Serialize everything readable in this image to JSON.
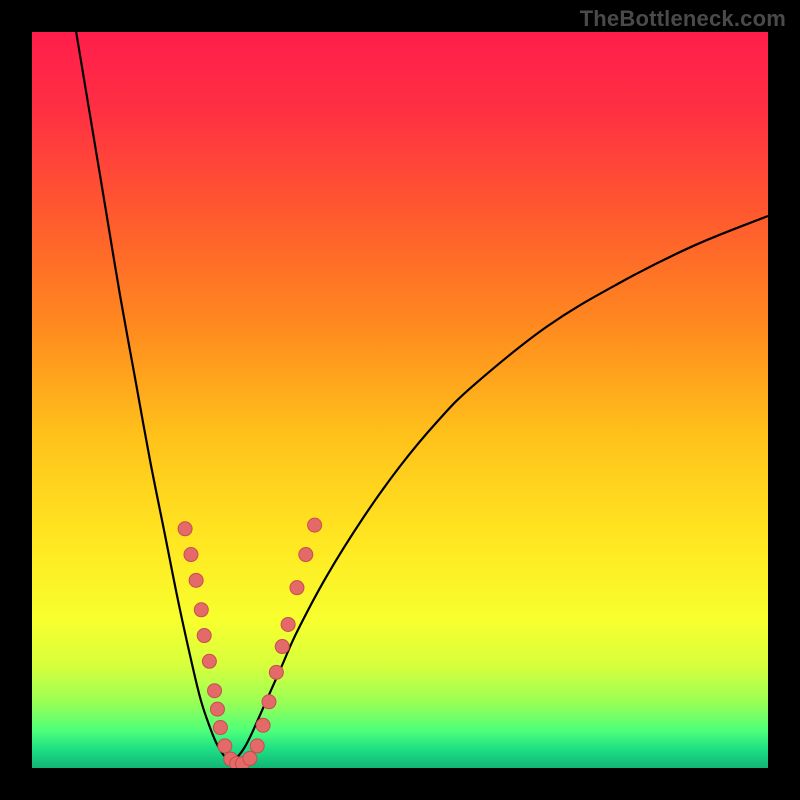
{
  "watermark": "TheBottleneck.com",
  "colors": {
    "black": "#000000",
    "curve": "#000000",
    "dot_fill": "#e46a6a",
    "dot_stroke": "#c84d4d"
  },
  "gradient_stops": [
    {
      "offset": 0.0,
      "color": "#ff1e4b"
    },
    {
      "offset": 0.1,
      "color": "#ff2e44"
    },
    {
      "offset": 0.25,
      "color": "#ff5a2e"
    },
    {
      "offset": 0.4,
      "color": "#ff8a1f"
    },
    {
      "offset": 0.55,
      "color": "#ffc21a"
    },
    {
      "offset": 0.7,
      "color": "#ffe922"
    },
    {
      "offset": 0.8,
      "color": "#f7ff2e"
    },
    {
      "offset": 0.86,
      "color": "#d7ff3c"
    },
    {
      "offset": 0.91,
      "color": "#9bff55"
    },
    {
      "offset": 0.95,
      "color": "#4cff7a"
    },
    {
      "offset": 0.975,
      "color": "#1cdf84"
    },
    {
      "offset": 1.0,
      "color": "#12b574"
    }
  ],
  "chart_data": {
    "type": "line",
    "title": "",
    "xlabel": "",
    "ylabel": "",
    "xlim": [
      0,
      100
    ],
    "ylim": [
      0,
      100
    ],
    "series": [
      {
        "name": "bottleneck-curve-left",
        "x": [
          6,
          8,
          10,
          12,
          14,
          16,
          18,
          20,
          22,
          23,
          24,
          25,
          26,
          27
        ],
        "y": [
          100,
          88,
          76,
          64,
          53,
          42,
          32,
          22,
          13,
          9,
          6,
          3.5,
          1.8,
          0.8
        ]
      },
      {
        "name": "bottleneck-curve-right",
        "x": [
          27,
          28,
          29,
          30,
          32,
          34,
          36,
          40,
          45,
          50,
          55,
          60,
          70,
          80,
          90,
          100
        ],
        "y": [
          0.8,
          1.6,
          3,
          5,
          9.5,
          14,
          18.5,
          26,
          34,
          41,
          47,
          52,
          60,
          66,
          71,
          75
        ]
      }
    ],
    "dots": [
      {
        "x": 20.8,
        "y": 32.5
      },
      {
        "x": 21.6,
        "y": 29.0
      },
      {
        "x": 22.3,
        "y": 25.5
      },
      {
        "x": 23.0,
        "y": 21.5
      },
      {
        "x": 23.4,
        "y": 18.0
      },
      {
        "x": 24.1,
        "y": 14.5
      },
      {
        "x": 24.8,
        "y": 10.5
      },
      {
        "x": 25.2,
        "y": 8.0
      },
      {
        "x": 25.6,
        "y": 5.5
      },
      {
        "x": 26.2,
        "y": 3.0
      },
      {
        "x": 27.0,
        "y": 1.2
      },
      {
        "x": 27.8,
        "y": 0.6
      },
      {
        "x": 28.6,
        "y": 0.6
      },
      {
        "x": 29.6,
        "y": 1.3
      },
      {
        "x": 30.6,
        "y": 3.0
      },
      {
        "x": 31.4,
        "y": 5.8
      },
      {
        "x": 32.2,
        "y": 9.0
      },
      {
        "x": 33.2,
        "y": 13.0
      },
      {
        "x": 34.0,
        "y": 16.5
      },
      {
        "x": 34.8,
        "y": 19.5
      },
      {
        "x": 36.0,
        "y": 24.5
      },
      {
        "x": 37.2,
        "y": 29.0
      },
      {
        "x": 38.4,
        "y": 33.0
      }
    ],
    "dot_radius": 7
  }
}
